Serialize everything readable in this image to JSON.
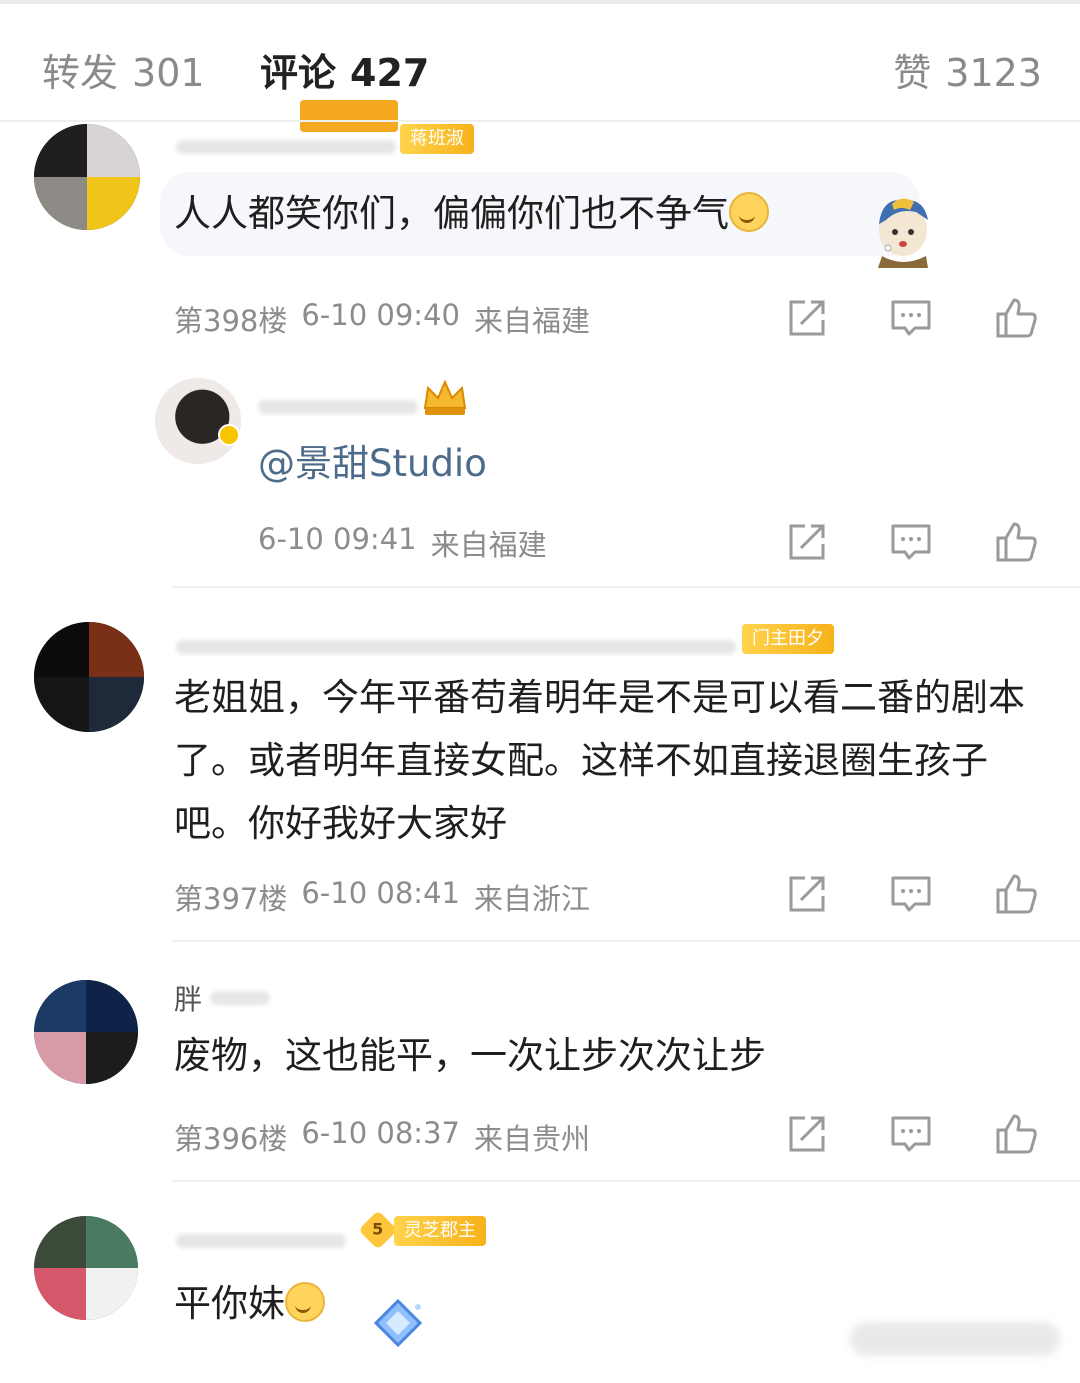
{
  "tabs": {
    "repost": {
      "label": "转发",
      "count": "301"
    },
    "comments": {
      "label": "评论",
      "count": "427"
    },
    "likes": {
      "label": "赞",
      "count": "3123"
    }
  },
  "comments": [
    {
      "badge": "蒋班淑",
      "text": "人人都笑你们，偏偏你们也不争气",
      "floor": "第398楼",
      "time": "6-10 09:40",
      "location": "来自福建"
    },
    {
      "text_mention": "@景甜Studio",
      "time": "6-10 09:41",
      "location": "来自福建"
    },
    {
      "badge": "门主田夕",
      "text": "老姐姐，今年平番苟着明年是不是可以看二番的剧本了。或者明年直接女配。这样不如直接退圈生孩子吧。你好我好大家好",
      "floor": "第397楼",
      "time": "6-10 08:41",
      "location": "来自浙江"
    },
    {
      "name_partial": "胖",
      "text": "废物，这也能平，一次让步次次让步",
      "floor": "第396楼",
      "time": "6-10 08:37",
      "location": "来自贵州"
    },
    {
      "level": "5",
      "badge": "灵芝郡主",
      "text": "平你妹"
    }
  ],
  "icons": {
    "share": "share-icon",
    "reply": "comment-icon",
    "like": "thumbs-up-icon"
  },
  "colors": {
    "accent": "#f4a820",
    "meta": "#8c8c8c",
    "mention": "#4d6b8a"
  }
}
